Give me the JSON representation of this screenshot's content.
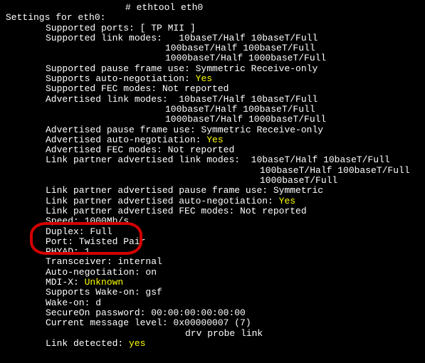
{
  "cmd": "# ethtool eth0",
  "header": "Settings for eth0:",
  "supported_ports": "Supported ports: [ TP MII ]",
  "supported_link_modes_label": "Supported link modes:   ",
  "supported_link_modes_1": "10baseT/Half 10baseT/Full",
  "supported_link_modes_2": "100baseT/Half 100baseT/Full",
  "supported_link_modes_3": "1000baseT/Half 1000baseT/Full",
  "supported_pause": "Supported pause frame use: Symmetric Receive-only",
  "supports_auto_neg_label": "Supports auto-negotiation: ",
  "supports_auto_neg_val": "Yes",
  "supported_fec": "Supported FEC modes: Not reported",
  "adv_link_modes_label": "Advertised link modes:  ",
  "adv_link_modes_1": "10baseT/Half 10baseT/Full",
  "adv_link_modes_2": "100baseT/Half 100baseT/Full",
  "adv_link_modes_3": "1000baseT/Half 1000baseT/Full",
  "adv_pause": "Advertised pause frame use: Symmetric Receive-only",
  "adv_auto_neg_label": "Advertised auto-negotiation: ",
  "adv_auto_neg_val": "Yes",
  "adv_fec": "Advertised FEC modes: Not reported",
  "lp_link_modes_label": "Link partner advertised link modes:  ",
  "lp_link_modes_1": "10baseT/Half 10baseT/Full",
  "lp_link_modes_2": "100baseT/Half 100baseT/Full",
  "lp_link_modes_3": "1000baseT/Full",
  "lp_pause": "Link partner advertised pause frame use: Symmetric",
  "lp_auto_neg_label": "Link partner advertised auto-negotiation: ",
  "lp_auto_neg_val": "Yes",
  "lp_fec": "Link partner advertised FEC modes: Not reported",
  "speed": "Speed: 1000Mb/s",
  "duplex": "Duplex: Full",
  "port": "Port: Twisted Pair",
  "phyad": "PHYAD: 1",
  "transceiver": "Transceiver: internal",
  "auto_neg": "Auto-negotiation: on",
  "mdix_label": "MDI-X: ",
  "mdix_val": "Unknown",
  "wake_on_supports": "Supports Wake-on: gsf",
  "wake_on": "Wake-on: d",
  "secureon": "SecureOn password: 00:00:00:00:00:00",
  "msg_level": "Current message level: 0x00000007 (7)",
  "msg_level_detail": "drv probe link",
  "link_detected_label": "Link detected: ",
  "link_detected_val": "yes"
}
